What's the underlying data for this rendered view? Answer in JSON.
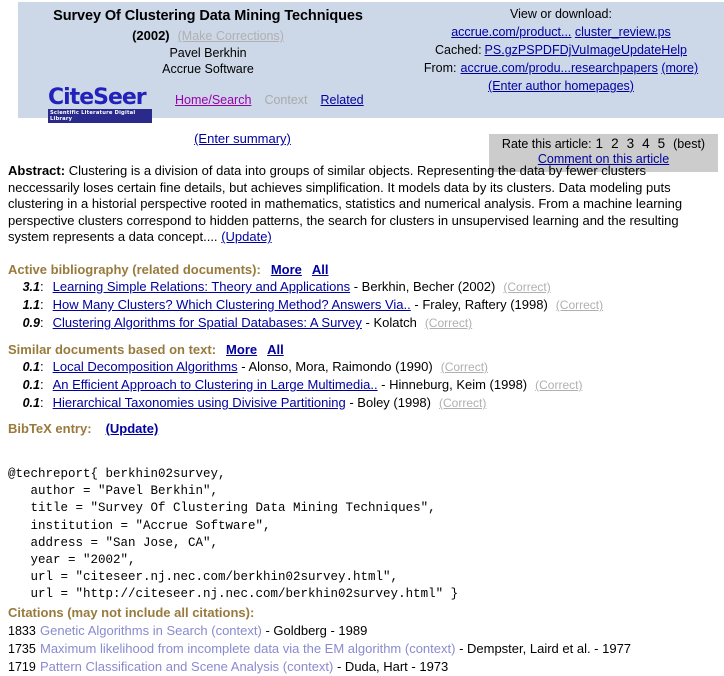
{
  "banner": {
    "title": "Survey Of Clustering Data Mining Techniques",
    "year": "(2002)",
    "make_corrections": "(Make Corrections)",
    "author": "Pavel Berkhin",
    "affiliation": "Accrue Software",
    "logo_word": "CiteSeer",
    "logo_tagline": "Scientific Literature Digital Library",
    "nav": [
      {
        "label": "Home/Search",
        "style": "purple"
      },
      {
        "label": "Context",
        "style": "grey"
      },
      {
        "label": "Related",
        "style": "link"
      }
    ],
    "view_or_download_label": "View or download:",
    "download_links": [
      "accrue.com/product...",
      "cluster_review.ps"
    ],
    "cached_label": "Cached:",
    "cached_links": [
      "PS.gz",
      "PS",
      "PDF",
      "DjVu",
      "Image",
      "Update",
      "Help"
    ],
    "from_label": "From:",
    "from_links": [
      "accrue.com/produ...",
      "researchpapers",
      "(more)"
    ],
    "enter_author_homepages": "(Enter author homepages)"
  },
  "summary": {
    "enter_summary": "(Enter summary)"
  },
  "rate": {
    "label": "Rate this article:",
    "values": [
      "1",
      "2",
      "3",
      "4",
      "5"
    ],
    "best": "(best)",
    "comment": "Comment on this article",
    "background": "#cccccc"
  },
  "abstract": {
    "label": "Abstract:",
    "text": "Clustering is a division of data into groups of similar objects. Representing the data by fewer clusters neccessarily loses certain fine details, but achieves simplification. It models data by its clusters. Data modeling puts clustering in a historial perspective rooted in mathematics, statistics and numerical analysis. From a machine learning perspective clusters correspond to hidden patterns, the search for clusters in unsupervised learning and the resulting system represents a data concept....",
    "update": "(Update)"
  },
  "active_bibliography": {
    "heading": "Active bibliography (related documents):",
    "more": "More",
    "all": "All",
    "rows": [
      {
        "score": "3.1",
        "title": "Learning Simple Relations: Theory and Applications",
        "tail": " - Berkhin, Becher (2002)",
        "correct": "(Correct)"
      },
      {
        "score": "1.1",
        "title": "How Many Clusters? Which Clustering Method? Answers Via..",
        "tail": " - Fraley, Raftery (1998)",
        "correct": "(Correct)"
      },
      {
        "score": "0.9",
        "title": "Clustering Algorithms for Spatial Databases: A Survey",
        "tail": " - Kolatch",
        "correct": "(Correct)"
      }
    ]
  },
  "similar_documents": {
    "heading": "Similar documents based on text:",
    "more": "More",
    "all": "All",
    "rows": [
      {
        "score": "0.1",
        "title": "Local Decomposition Algorithms",
        "tail": " - Alonso, Mora, Raimondo (1990)",
        "correct": "(Correct)"
      },
      {
        "score": "0.1",
        "title": "An Efficient Approach to Clustering in Large Multimedia..",
        "tail": " - Hinneburg, Keim (1998)",
        "correct": "(Correct)"
      },
      {
        "score": "0.1",
        "title": "Hierarchical Taxonomies using Divisive Partitioning",
        "tail": " - Boley (1998)",
        "correct": "(Correct)"
      }
    ]
  },
  "bibtex": {
    "heading": "BibTeX entry:",
    "update": "(Update)",
    "entry": "@techreport{ berkhin02survey,\n   author = \"Pavel Berkhin\",\n   title = \"Survey Of Clustering Data Mining Techniques\",\n   institution = \"Accrue Software\",\n   address = \"San Jose, CA\",\n   year = \"2002\",\n   url = \"citeseer.nj.nec.com/berkhin02survey.html\",\n   url = \"http://citeseer.nj.nec.com/berkhin02survey.html\" }"
  },
  "citations": {
    "heading": "Citations (may not include all citations):",
    "rows": [
      {
        "count": "1833",
        "title": "Genetic Algorithms in Search (context)",
        "tail": " - Goldberg - 1989"
      },
      {
        "count": "1735",
        "title": "Maximum likelihood from incomplete data via the EM algorithm (context)",
        "tail": " - Dempster, Laird et al. - 1977"
      },
      {
        "count": "1719",
        "title": "Pattern Classification and Scene Analysis (context)",
        "tail": " - Duda, Hart - 1973"
      }
    ]
  },
  "colors": {
    "banner_bg": "#ccd7e8",
    "link": "#0000a0",
    "section_heading": "#997a3d",
    "citation_link": "#8a8ad0"
  }
}
